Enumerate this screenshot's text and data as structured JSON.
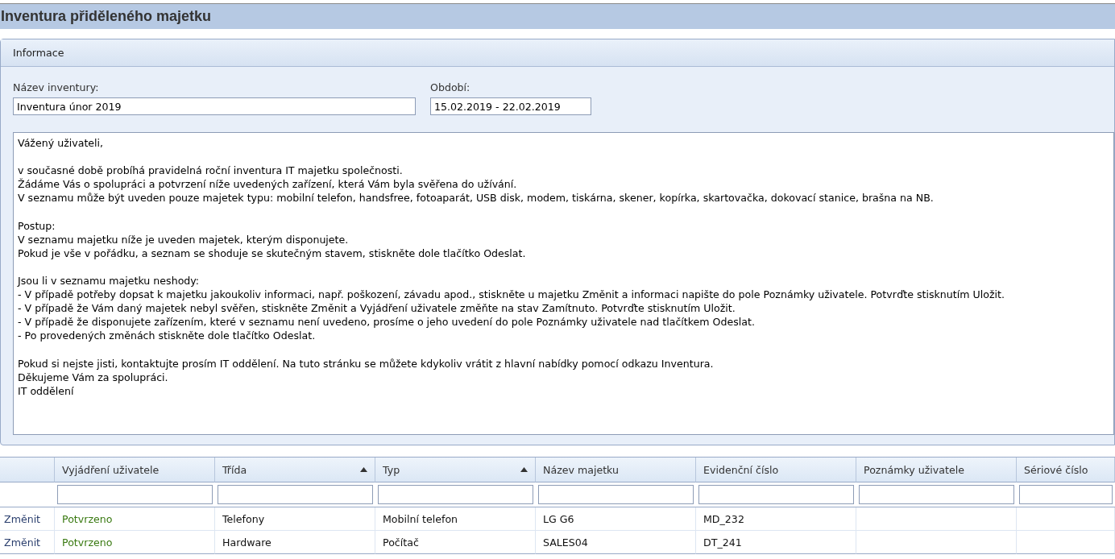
{
  "page_title": "Inventura přiděleného majetku",
  "panel": {
    "title": "Informace",
    "fields": [
      {
        "label": "Název inventury:",
        "value": "Inventura únor 2019"
      },
      {
        "label": "Období:",
        "value": "15.02.2019 - 22.02.2019"
      }
    ],
    "message": [
      [
        "Vážený uživateli,"
      ],
      [
        "v současné době probíhá pravidelná roční inventura IT majetku společnosti.",
        "Žádáme Vás o spolupráci a potvrzení níže uvedených zařízení, která Vám byla svěřena do užívání.",
        "V seznamu může být uveden pouze majetek typu: mobilní telefon, handsfree, fotoaparát, USB disk, modem, tiskárna, skener, kopírka, skartovačka, dokovací stanice, brašna na NB."
      ],
      [
        "Postup:",
        "V seznamu majetku níže je uveden majetek, kterým disponujete.",
        "Pokud je vše v pořádku, a seznam se shoduje se skutečným stavem, stiskněte dole tlačítko Odeslat."
      ],
      [
        "Jsou li v seznamu majetku neshody:",
        "- V případě potřeby dopsat k majetku jakoukoliv informaci, např. poškození, závadu apod., stiskněte u majetku Změnit a informaci napište do pole Poznámky uživatele. Potvrďte stisknutím Uložit.",
        "- V případě že Vám daný majetek nebyl svěřen, stiskněte Změnit a Vyjádření uživatele změňte na stav Zamítnuto. Potvrďte stisknutím Uložit.",
        "- V případě že disponujete zařízením, které v seznamu není uvedeno, prosíme o jeho uvedení do pole Poznámky uživatele nad tlačítkem Odeslat.",
        "- Po provedených změnách stiskněte dole tlačítko Odeslat."
      ],
      [
        "Pokud si nejste jisti, kontaktujte prosím IT oddělení. Na tuto stránku se můžete kdykoliv vrátit z hlavní nabídky pomocí odkazu Inventura.",
        "Děkujeme Vám za spolupráci.",
        "IT oddělení"
      ]
    ]
  },
  "table": {
    "columns": [
      {
        "label": "Vyjádření uživatele",
        "sorted": false
      },
      {
        "label": "Třída",
        "sorted": true
      },
      {
        "label": "Typ",
        "sorted": true
      },
      {
        "label": "Název majetku",
        "sorted": false
      },
      {
        "label": "Evidenční číslo",
        "sorted": false
      },
      {
        "label": "Poznámky uživatele",
        "sorted": false
      },
      {
        "label": "Sériové číslo",
        "sorted": false
      }
    ],
    "rows": [
      {
        "action": "Změnit",
        "cells": [
          "Potvrzeno",
          "Telefony",
          "Mobilní telefon",
          "LG G6",
          "MD_232",
          null,
          null
        ]
      },
      {
        "action": "Změnit",
        "cells": [
          "Potvrzeno",
          "Hardware",
          "Počítač",
          "SALES04",
          "DT_241",
          null,
          null
        ]
      }
    ]
  }
}
